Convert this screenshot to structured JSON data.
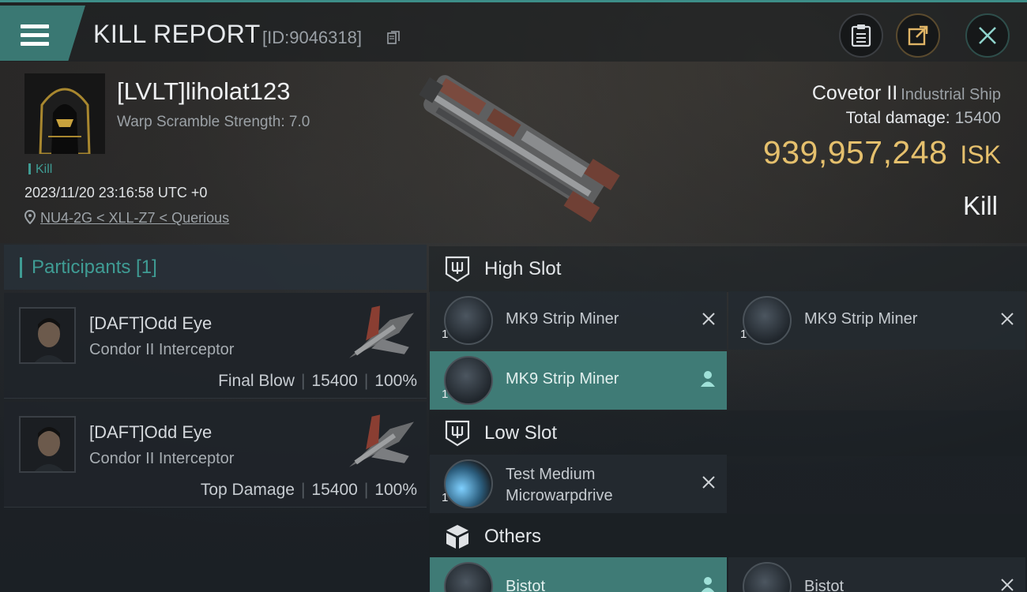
{
  "header": {
    "title": "KILL REPORT",
    "report_id": "[ID:9046318]"
  },
  "victim": {
    "name": "[LVLT]liholat123",
    "warp_scramble": "Warp Scramble Strength: 7.0",
    "result_tag": "Kill",
    "timestamp": "2023/11/20 23:16:58 UTC +0",
    "location": "NU4-2G < XLL-Z7 < Querious",
    "ship_name": "Covetor II",
    "ship_class": "Industrial Ship",
    "total_damage_label": "Total damage:",
    "total_damage": "15400",
    "isk_value": "939,957,248",
    "isk_unit": "ISK",
    "result_big": "Kill"
  },
  "participants": {
    "header": "Participants [1]",
    "items": [
      {
        "name": "[DAFT]Odd Eye",
        "ship": "Condor II Interceptor",
        "role": "Final Blow",
        "damage": "15400",
        "percent": "100%"
      },
      {
        "name": "[DAFT]Odd Eye",
        "ship": "Condor II Interceptor",
        "role": "Top Damage",
        "damage": "15400",
        "percent": "100%"
      }
    ]
  },
  "slots": {
    "high": {
      "title": "High Slot",
      "modules": [
        {
          "name": "MK9 Strip Miner",
          "qty": "1"
        },
        {
          "name": "MK9 Strip Miner",
          "qty": "1"
        },
        {
          "name": "MK9 Strip Miner",
          "qty": "1"
        }
      ]
    },
    "low": {
      "title": "Low Slot",
      "modules": [
        {
          "name_line1": "Test Medium",
          "name_line2": "Microwarpdrive",
          "qty": "1"
        }
      ]
    },
    "others": {
      "title": "Others",
      "modules": [
        {
          "name": "Bistot"
        },
        {
          "name": "Bistot"
        }
      ]
    }
  }
}
